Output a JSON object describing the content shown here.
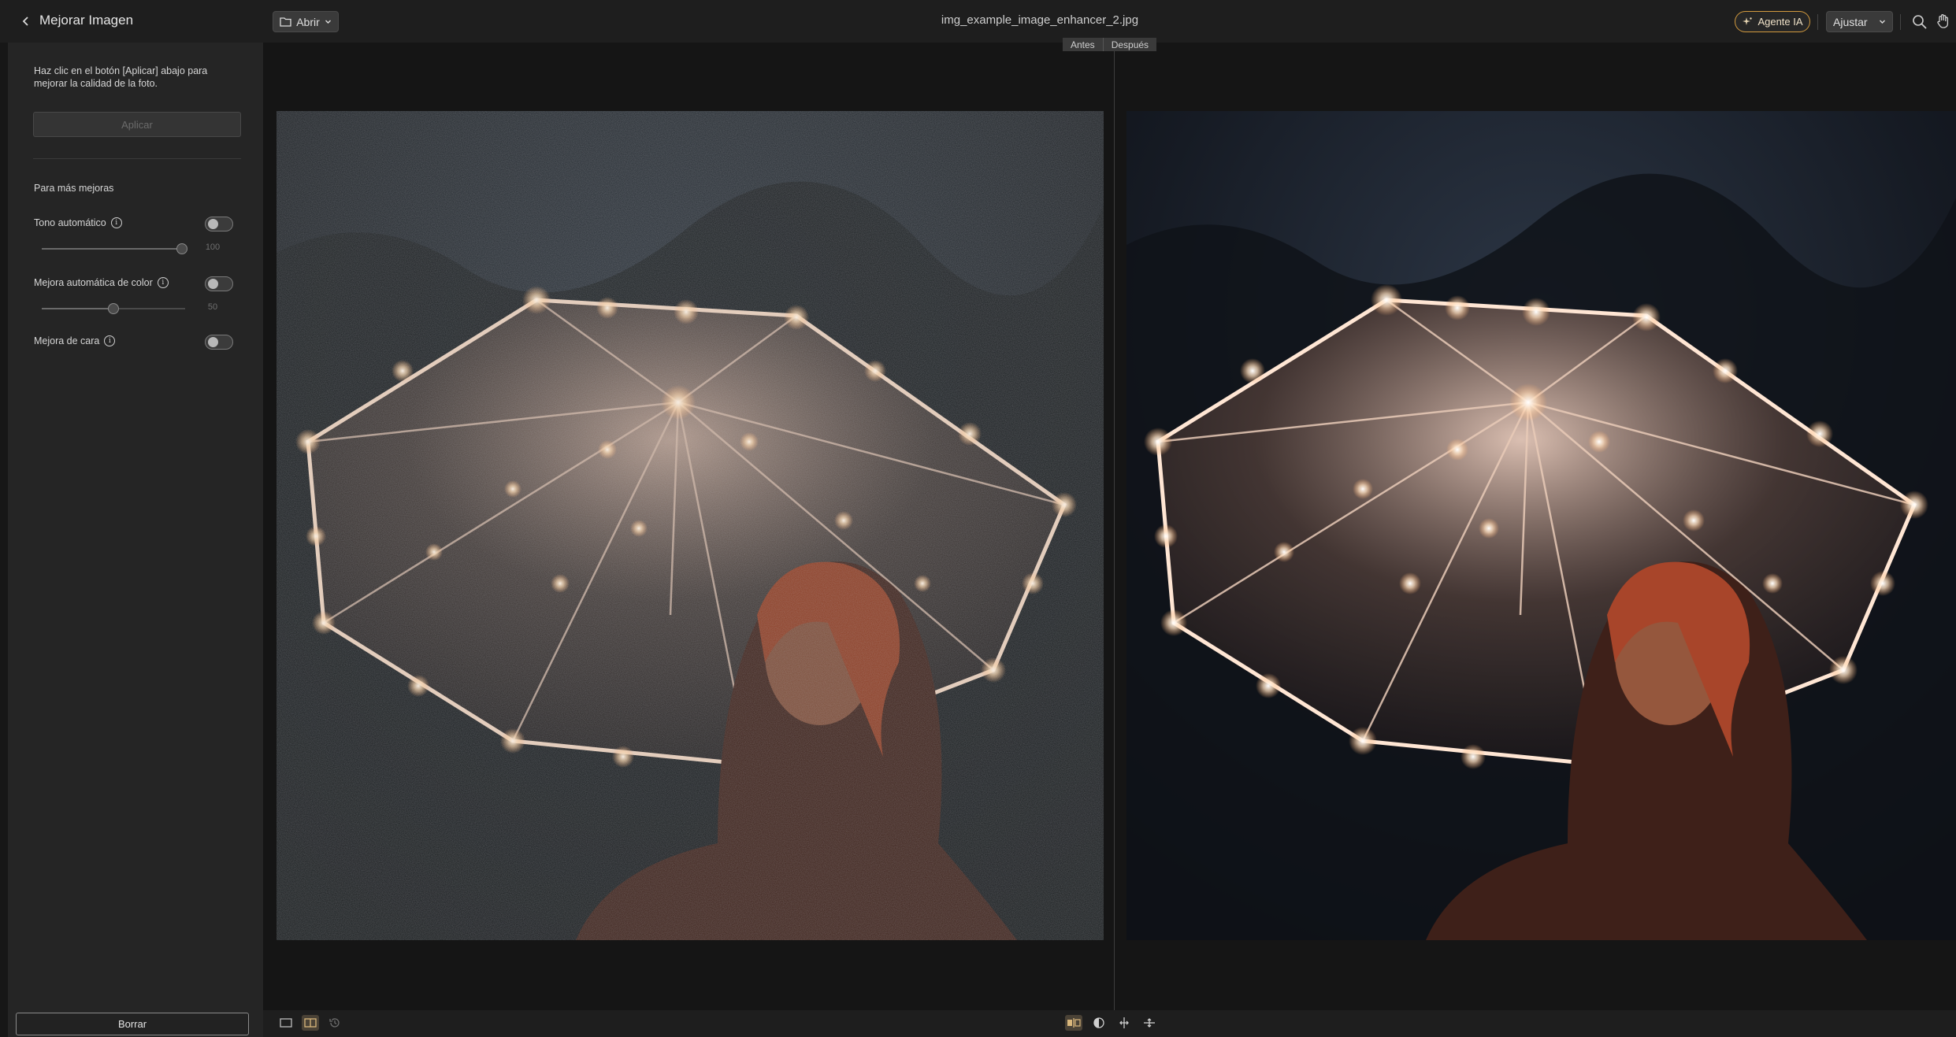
{
  "header": {
    "panel_title": "Mejorar Imagen",
    "open_label": "Abrir",
    "filename": "img_example_image_enhancer_2.jpg",
    "ai_agent_label": "Agente IA",
    "fit_label": "Ajustar",
    "accent_color": "#d39a3e"
  },
  "panel": {
    "hint": "Haz clic en el botón [Aplicar] abajo para mejorar la calidad de la foto.",
    "apply_label": "Aplicar",
    "more_heading": "Para más mejoras",
    "options": [
      {
        "label": "Tono automático",
        "enabled": false,
        "slider_value": "100",
        "slider_fraction": 1.0
      },
      {
        "label": "Mejora automática de color",
        "enabled": false,
        "slider_value": "50",
        "slider_fraction": 0.5
      },
      {
        "label": "Mejora de cara",
        "enabled": false
      }
    ],
    "clear_label": "Borrar"
  },
  "compare": {
    "before_label": "Antes",
    "after_label": "Después"
  },
  "icons": {
    "back": "chevron-left-icon",
    "folder": "folder-icon",
    "ai": "sparkle-icon",
    "zoom": "search-icon",
    "hand": "hand-icon"
  }
}
